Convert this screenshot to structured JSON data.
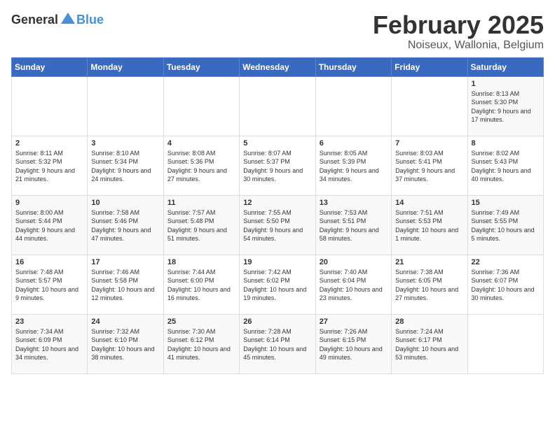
{
  "header": {
    "logo_general": "General",
    "logo_blue": "Blue",
    "month_title": "February 2025",
    "location": "Noiseux, Wallonia, Belgium"
  },
  "days_of_week": [
    "Sunday",
    "Monday",
    "Tuesday",
    "Wednesday",
    "Thursday",
    "Friday",
    "Saturday"
  ],
  "weeks": [
    [
      {
        "day": "",
        "info": ""
      },
      {
        "day": "",
        "info": ""
      },
      {
        "day": "",
        "info": ""
      },
      {
        "day": "",
        "info": ""
      },
      {
        "day": "",
        "info": ""
      },
      {
        "day": "",
        "info": ""
      },
      {
        "day": "1",
        "info": "Sunrise: 8:13 AM\nSunset: 5:30 PM\nDaylight: 9 hours and 17 minutes."
      }
    ],
    [
      {
        "day": "2",
        "info": "Sunrise: 8:11 AM\nSunset: 5:32 PM\nDaylight: 9 hours and 21 minutes."
      },
      {
        "day": "3",
        "info": "Sunrise: 8:10 AM\nSunset: 5:34 PM\nDaylight: 9 hours and 24 minutes."
      },
      {
        "day": "4",
        "info": "Sunrise: 8:08 AM\nSunset: 5:36 PM\nDaylight: 9 hours and 27 minutes."
      },
      {
        "day": "5",
        "info": "Sunrise: 8:07 AM\nSunset: 5:37 PM\nDaylight: 9 hours and 30 minutes."
      },
      {
        "day": "6",
        "info": "Sunrise: 8:05 AM\nSunset: 5:39 PM\nDaylight: 9 hours and 34 minutes."
      },
      {
        "day": "7",
        "info": "Sunrise: 8:03 AM\nSunset: 5:41 PM\nDaylight: 9 hours and 37 minutes."
      },
      {
        "day": "8",
        "info": "Sunrise: 8:02 AM\nSunset: 5:43 PM\nDaylight: 9 hours and 40 minutes."
      }
    ],
    [
      {
        "day": "9",
        "info": "Sunrise: 8:00 AM\nSunset: 5:44 PM\nDaylight: 9 hours and 44 minutes."
      },
      {
        "day": "10",
        "info": "Sunrise: 7:58 AM\nSunset: 5:46 PM\nDaylight: 9 hours and 47 minutes."
      },
      {
        "day": "11",
        "info": "Sunrise: 7:57 AM\nSunset: 5:48 PM\nDaylight: 9 hours and 51 minutes."
      },
      {
        "day": "12",
        "info": "Sunrise: 7:55 AM\nSunset: 5:50 PM\nDaylight: 9 hours and 54 minutes."
      },
      {
        "day": "13",
        "info": "Sunrise: 7:53 AM\nSunset: 5:51 PM\nDaylight: 9 hours and 58 minutes."
      },
      {
        "day": "14",
        "info": "Sunrise: 7:51 AM\nSunset: 5:53 PM\nDaylight: 10 hours and 1 minute."
      },
      {
        "day": "15",
        "info": "Sunrise: 7:49 AM\nSunset: 5:55 PM\nDaylight: 10 hours and 5 minutes."
      }
    ],
    [
      {
        "day": "16",
        "info": "Sunrise: 7:48 AM\nSunset: 5:57 PM\nDaylight: 10 hours and 9 minutes."
      },
      {
        "day": "17",
        "info": "Sunrise: 7:46 AM\nSunset: 5:58 PM\nDaylight: 10 hours and 12 minutes."
      },
      {
        "day": "18",
        "info": "Sunrise: 7:44 AM\nSunset: 6:00 PM\nDaylight: 10 hours and 16 minutes."
      },
      {
        "day": "19",
        "info": "Sunrise: 7:42 AM\nSunset: 6:02 PM\nDaylight: 10 hours and 19 minutes."
      },
      {
        "day": "20",
        "info": "Sunrise: 7:40 AM\nSunset: 6:04 PM\nDaylight: 10 hours and 23 minutes."
      },
      {
        "day": "21",
        "info": "Sunrise: 7:38 AM\nSunset: 6:05 PM\nDaylight: 10 hours and 27 minutes."
      },
      {
        "day": "22",
        "info": "Sunrise: 7:36 AM\nSunset: 6:07 PM\nDaylight: 10 hours and 30 minutes."
      }
    ],
    [
      {
        "day": "23",
        "info": "Sunrise: 7:34 AM\nSunset: 6:09 PM\nDaylight: 10 hours and 34 minutes."
      },
      {
        "day": "24",
        "info": "Sunrise: 7:32 AM\nSunset: 6:10 PM\nDaylight: 10 hours and 38 minutes."
      },
      {
        "day": "25",
        "info": "Sunrise: 7:30 AM\nSunset: 6:12 PM\nDaylight: 10 hours and 41 minutes."
      },
      {
        "day": "26",
        "info": "Sunrise: 7:28 AM\nSunset: 6:14 PM\nDaylight: 10 hours and 45 minutes."
      },
      {
        "day": "27",
        "info": "Sunrise: 7:26 AM\nSunset: 6:15 PM\nDaylight: 10 hours and 49 minutes."
      },
      {
        "day": "28",
        "info": "Sunrise: 7:24 AM\nSunset: 6:17 PM\nDaylight: 10 hours and 53 minutes."
      },
      {
        "day": "",
        "info": ""
      }
    ]
  ]
}
